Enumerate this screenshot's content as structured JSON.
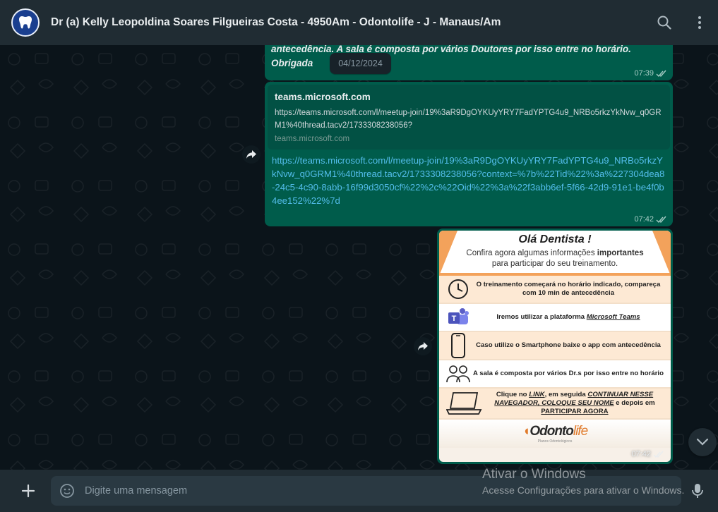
{
  "header": {
    "title": "Dr (a) Kelly Leopoldina Soares Filgueiras Costa - 4950Am - Odontolife - J - Manaus/Am",
    "avatar_icon": "tooth-logo-icon",
    "search_icon": "search-icon",
    "menu_icon": "more-vertical-icon"
  },
  "chat": {
    "date_pill": "04/12/2024",
    "messages": [
      {
        "text": "antecedência. A sala é composta por vários Doutores por isso entre no horário. Obrigada",
        "time": "07:39"
      },
      {
        "preview_title": "teams.microsoft.com",
        "preview_desc": "https://teams.microsoft.com/l/meetup-join/19%3aR9DgOYKUyYRY7FadYPTG4u9_NRBo5rkzYkNvw_q0GRM1%40thread.tacv2/1733308238056?",
        "preview_domain": "teams.microsoft.com",
        "link": "https://teams.microsoft.com/l/meetup-join/19%3aR9DgOYKUyYRY7FadYPTG4u9_NRBo5rkzYkNvw_q0GRM1%40thread.tacv2/1733308238056?context=%7b%22Tid%22%3a%227304dea8-24c5-4c90-8abb-16f99d3050cf%22%2c%22Oid%22%3a%22f3abb6ef-5f66-42d9-91e1-be4f0b4ee152%22%7d",
        "time": "07:42"
      },
      {
        "image": {
          "title": "Olá Dentista !",
          "subtitle_1": "Confira agora algumas informações",
          "subtitle_bold": "importantes",
          "subtitle_2": "para participar do seu treinamento.",
          "rows": [
            {
              "icon": "clock-icon",
              "text": "O treinamento começará no horário indicado, compareça com 10 min de antecedência"
            },
            {
              "icon": "teams-icon",
              "text_pre": "Iremos utilizar a plataforma",
              "text_link": "Microsoft Teams"
            },
            {
              "icon": "smartphone-icon",
              "text": "Caso utilize o Smartphone baixe o app com antecedência"
            },
            {
              "icon": "people-icon",
              "text": "A sala é composta por vários Dr.s por isso entre no horário"
            },
            {
              "icon": "laptop-icon",
              "t1": "Clique no",
              "t2": "LINK",
              "t3": ", em seguida",
              "t4": "CONTINUAR NESSE NAVEGADOR, COLOQUE SEU NOME",
              "t5": "e depois em",
              "t6": "PARTICIPAR AGORA"
            }
          ],
          "logo_left": "Odonto",
          "logo_right": "life",
          "logo_sub": "Planos Odontológicos"
        },
        "time": "07:42"
      }
    ]
  },
  "footer": {
    "placeholder": "Digite uma mensagem",
    "plus_icon": "plus-icon",
    "emoji_icon": "sticker-icon",
    "mic_icon": "mic-icon"
  },
  "watermark": {
    "line1": "Ativar o Windows",
    "line2": "Acesse Configurações para ativar o Windows."
  }
}
